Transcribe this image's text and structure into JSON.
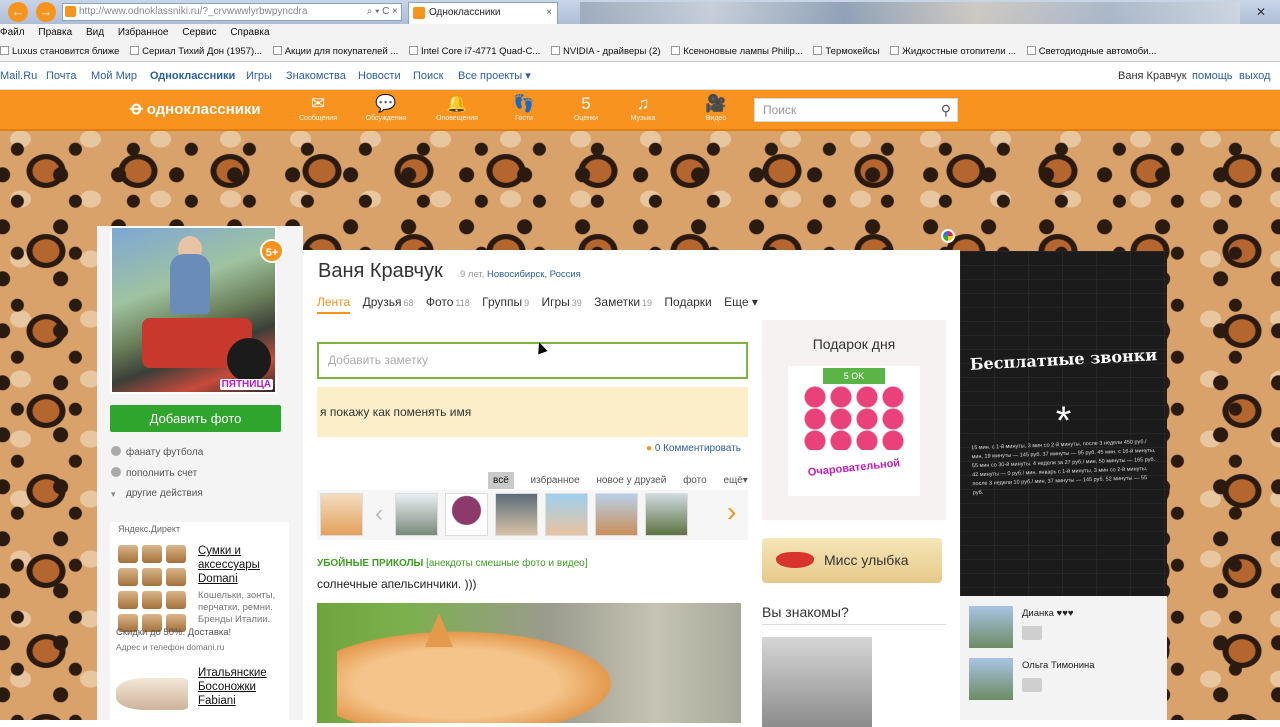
{
  "browser": {
    "url": "http://www.odnoklassniki.ru/?_crvwwwlyrbwpyncdra",
    "tab_title": "Одноклассники",
    "tab_close": "×",
    "window_close": "✕",
    "menu": [
      "Файл",
      "Правка",
      "Вид",
      "Избранное",
      "Сервис",
      "Справка"
    ],
    "favorites": [
      "Luxus становится ближе",
      "Сериал Тихий Дон (1957)...",
      "Акции для покупателей ...",
      "Intel Core i7-4771 Quad-C...",
      "NVIDIA - драйверы (2)",
      "Ксеноновые лампы Philip...",
      "Термокейсы",
      "Жидкостные отопители ...",
      "Светодиодные автомоби..."
    ]
  },
  "mailru": {
    "links": [
      "Mail.Ru",
      "Почта",
      "Мой Мир",
      "Одноклассники",
      "Игры",
      "Знакомства",
      "Новости",
      "Поиск",
      "Все проекты ▾"
    ],
    "user": "Ваня Кравчук",
    "help": "помощь",
    "logout": "выход"
  },
  "okbar": {
    "logo": "одноклассники",
    "icons": [
      {
        "label": "Сообщения",
        "glyph": "✉"
      },
      {
        "label": "Обсуждения",
        "glyph": "💬"
      },
      {
        "label": "Оповещения",
        "glyph": "🔔"
      },
      {
        "label": "Гости",
        "glyph": "👣"
      },
      {
        "label": "Оценки",
        "glyph": "5"
      },
      {
        "label": "Музыка",
        "glyph": "♫"
      },
      {
        "label": "Видео",
        "glyph": "🎥"
      }
    ],
    "search_placeholder": "Поиск"
  },
  "left": {
    "level_badge": "5+",
    "avatar_badge": "ПЯТНИЦА",
    "add_photo": "Добавить фото",
    "links": [
      "фанату футбола",
      "пополнить счет",
      "другие действия"
    ],
    "yandex_title": "Яндекс.Директ",
    "ad1_title": "Сумки и аксессуары Domani",
    "ad1_text": "Кошельки, зонты, перчатки, ремни. Бренды Италии.",
    "ad1_sale": "Скидки до 50%. Доставка!",
    "ad1_addr": "Адрес и телефон domani.ru",
    "ad2_title": "Итальянские Босоножки Fabiani"
  },
  "profile": {
    "name": "Ваня Кравчук",
    "age": "9 лет,",
    "location": "Новосибирск, Россия",
    "tabs": [
      {
        "label": "Лента",
        "count": ""
      },
      {
        "label": "Друзья",
        "count": "68"
      },
      {
        "label": "Фото",
        "count": "118"
      },
      {
        "label": "Группы",
        "count": "9"
      },
      {
        "label": "Игры",
        "count": "39"
      },
      {
        "label": "Заметки",
        "count": "19"
      },
      {
        "label": "Подарки",
        "count": ""
      },
      {
        "label": "Еще ▾",
        "count": ""
      }
    ],
    "note_placeholder": "Добавить заметку",
    "status": "я покажу как поменять имя",
    "comment": "0 Комментировать",
    "filters": [
      "всё",
      "избранное",
      "новое у друзей",
      "фото",
      "ещё▾"
    ],
    "group_title": "УБОЙНЫЕ ПРИКОЛЫ",
    "group_sub": "[анекдоты смешные фото и видео]",
    "post_text": "солнечные апельсинчики. )))"
  },
  "gift": {
    "title": "Подарок дня",
    "price": "5 OK",
    "tag": "Очаровательной"
  },
  "miss": "Мисс улыбка",
  "know_title": "Вы знакомы?",
  "ad_black": {
    "title": "Бесплатные звонки",
    "star": "*",
    "fine_print": "15 мин. с 1-й минуты, 3 мин со 2-й минуты, после 3 недели 450 руб./ мин, 19 минуты — 145 руб. 37 минуты — 95 руб. 45 мин. с 16-й минуты, 55 мин со 30-й минуты. 4 недели за 27 руб./ мин, 50 минуты — 165 руб. 42 минуты — 0 руб./ мин. январь с 1-й минуты, 3 мин со 2-й минуты, после 3 недели 10 руб./ мин, 37 минуты — 145 руб. 52 минуты — 55 руб."
  },
  "friends": [
    "Дианка ♥♥♥",
    "Ольга Тимонина"
  ]
}
